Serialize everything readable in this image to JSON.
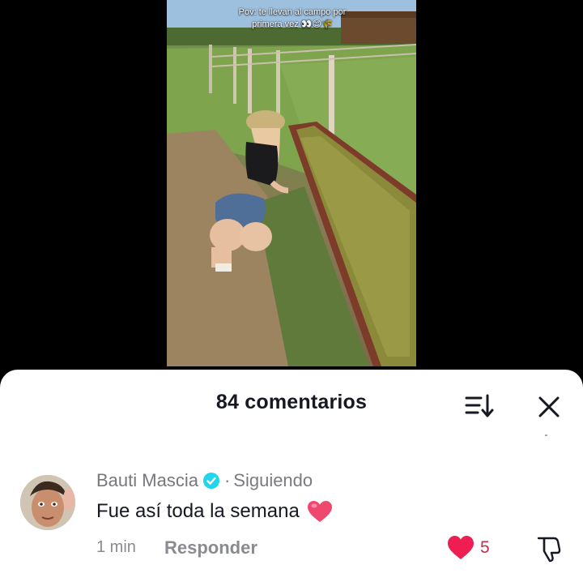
{
  "video": {
    "caption_line1": "Pov: te llevan al campo por",
    "caption_line2": "primera vez 👀😊🌾"
  },
  "comments_sheet": {
    "title": "84 comentarios",
    "sort_icon": "sort-icon",
    "close_icon": "close-icon"
  },
  "comment": {
    "author": "Bauti Mascia",
    "verified_icon": "verified-badge-icon",
    "separator": "·",
    "follow_status": "Siguiendo",
    "text": "Fue así toda la semana",
    "emoji": "red-heart",
    "time": "1 min",
    "reply_label": "Responder",
    "like_count": "5",
    "like_color": "#ee1d52",
    "verified_color": "#20d5ec"
  }
}
